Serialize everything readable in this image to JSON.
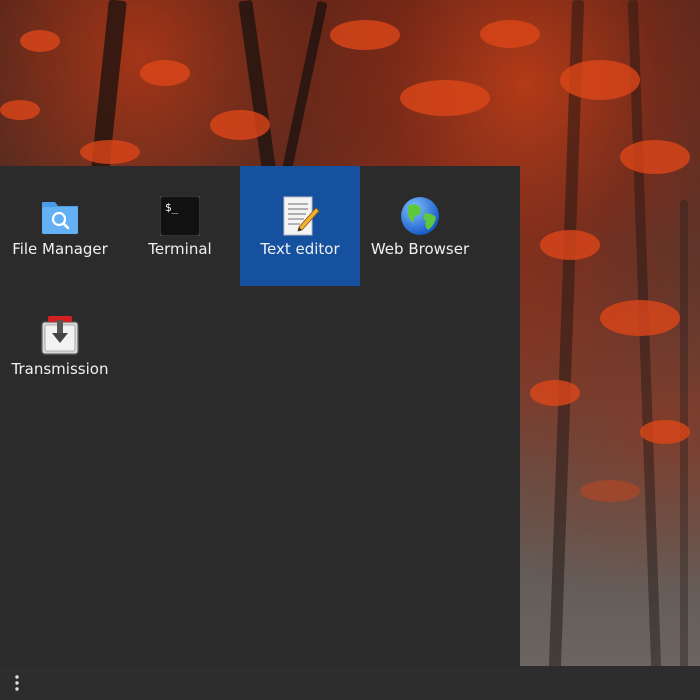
{
  "wallpaper": {
    "description_icon": "autumn-forest-wallpaper",
    "accent": "#c8401a"
  },
  "drawer": {
    "background": "#2b2b2b",
    "selected_color": "#16519f",
    "apps": [
      {
        "label": "File Manager",
        "icon": "folder-search-icon"
      },
      {
        "label": "Terminal",
        "icon": "terminal-icon"
      },
      {
        "label": "Text editor",
        "icon": "text-editor-icon",
        "selected": true
      },
      {
        "label": "Web Browser",
        "icon": "globe-icon"
      },
      {
        "label": "Transmission",
        "icon": "transmission-icon"
      }
    ]
  },
  "terminal_icon_text": "$_",
  "taskbar": {
    "menu_icon": "vertical-dots-icon"
  }
}
